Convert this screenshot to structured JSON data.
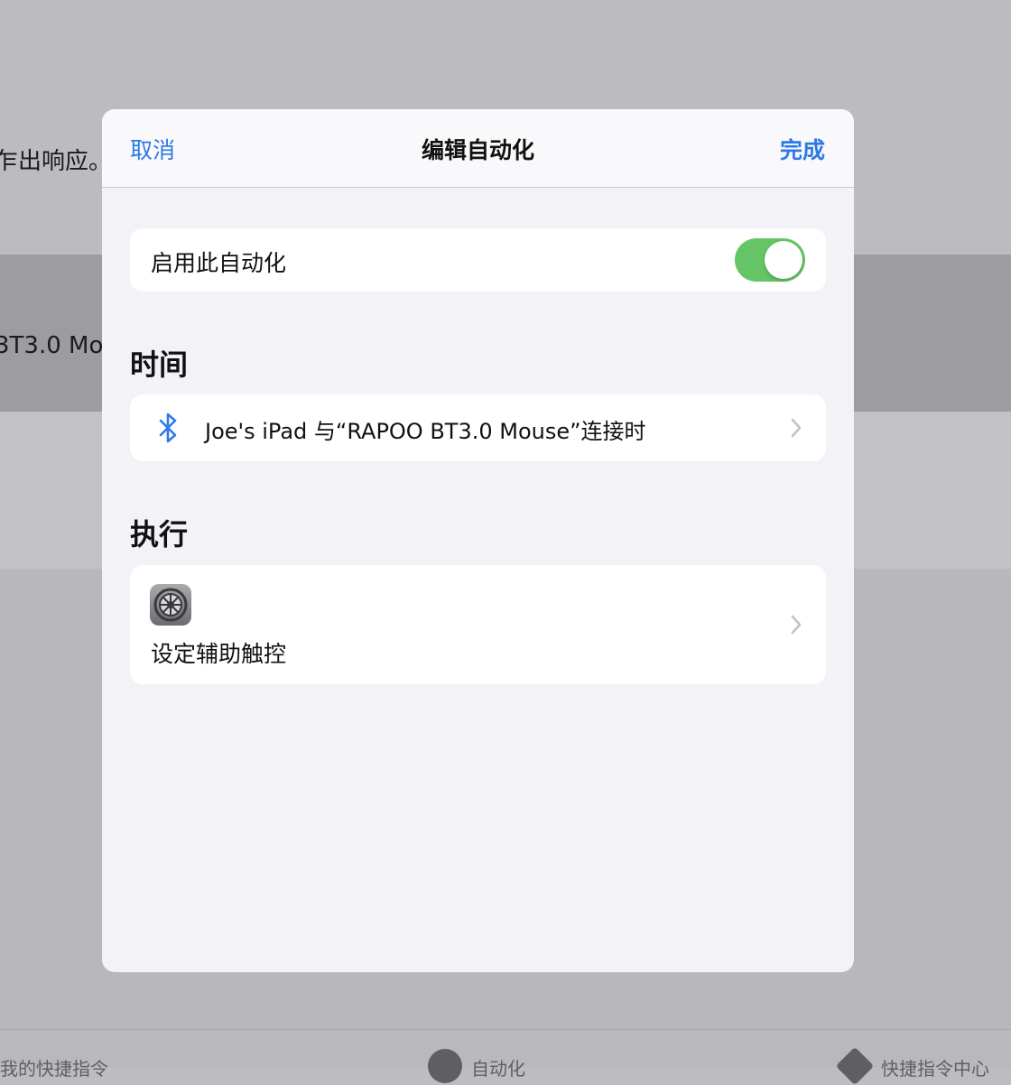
{
  "background": {
    "text_fragment_1": "乍出响应。",
    "text_fragment_2": "3T3.0 Mou",
    "tabs": [
      {
        "label": "我的快捷指令",
        "icon": "shortcuts-grid-icon"
      },
      {
        "label": "自动化",
        "icon": "automation-check-icon"
      },
      {
        "label": "快捷指令中心",
        "icon": "gallery-stack-icon"
      }
    ]
  },
  "modal": {
    "cancel_label": "取消",
    "title": "编辑自动化",
    "done_label": "完成",
    "enable": {
      "label": "启用此自动化",
      "toggle_on": true
    },
    "time_section": {
      "header": "时间",
      "trigger_icon": "bluetooth-icon",
      "trigger_text": "Joe's iPad 与“RAPOO BT3.0 Mouse”连接时"
    },
    "exec_section": {
      "header": "执行",
      "action_icon": "settings-gear-icon",
      "action_label": "设定辅助触控"
    }
  },
  "colors": {
    "accent": "#2f7ae5",
    "toggle_on": "#65c466",
    "sheet_background": "#f2f2f7"
  }
}
